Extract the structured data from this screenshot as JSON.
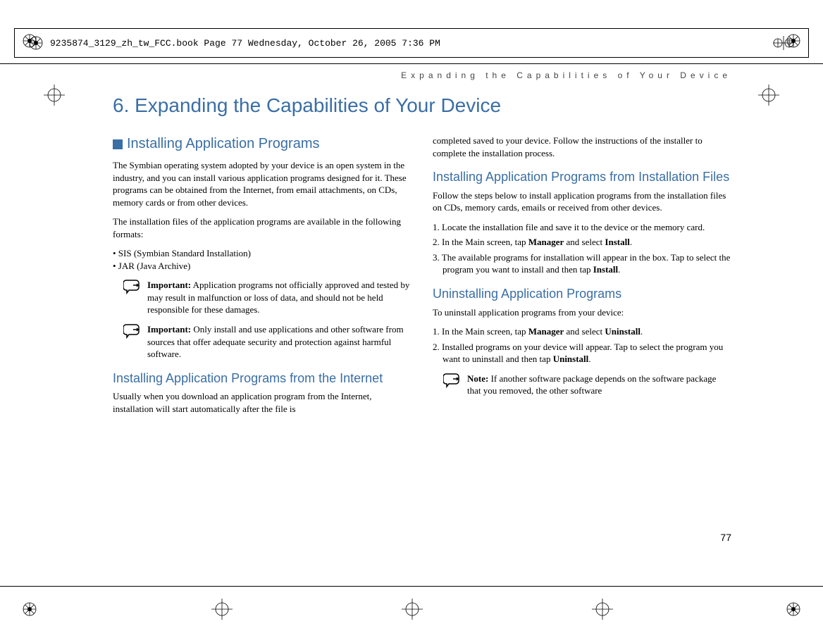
{
  "header": {
    "filemark": "9235874_3129_zh_tw_FCC.book  Page 77  Wednesday, October 26, 2005  7:36 PM"
  },
  "running_head": "Expanding the Capabilities of Your Device",
  "chapter": "6.   Expanding the Capabilities of Your Device",
  "left": {
    "h1": "Installing Application Programs",
    "p1": "The Symbian operating system adopted by your device is an open system in the industry, and you can install various application programs designed for it. These programs can be obtained from the Internet, from email attachments, on CDs, memory cards or from other devices.",
    "p2": "The installation files of the application programs are available in the following formats:",
    "b1": "• SIS (Symbian Standard Installation)",
    "b2": "• JAR (Java Archive)",
    "imp1_label": "Important:",
    "imp1": " Application programs not officially approved and tested by may result in malfunction or loss of data, and should not be held responsible for these damages.",
    "imp2_label": "Important:",
    "imp2": " Only install and use applications and other software from sources that offer adequate security and protection against harmful software.",
    "h2": "Installing Application Programs from the Internet",
    "p3": "Usually when you download an application program from the Internet, installation will start automatically after the file is"
  },
  "right": {
    "p1": "completed saved to your device. Follow the instructions of the installer to complete the installation process.",
    "h1": "Installing Application Programs from Installation Files",
    "p2": "Follow the steps below to install application programs from the installation files on CDs, memory cards, emails or received from other devices.",
    "s1": "1. Locate the installation file and save it to the device or the memory card.",
    "s2a": "2. In the Main screen, tap ",
    "s2b": "Manager",
    "s2c": " and select ",
    "s2d": "Install",
    "s2e": ".",
    "s3a": "3. The available programs for installation will appear in the box. Tap to select the program you want to install and then tap ",
    "s3b": "Install",
    "s3c": ".",
    "h2": "Uninstalling Application Programs",
    "p3": "To uninstall application programs from your device:",
    "u1a": "1. In the Main screen, tap ",
    "u1b": "Manager",
    "u1c": " and select ",
    "u1d": "Uninstall",
    "u1e": ".",
    "u2a": "2. Installed programs on your device will appear. Tap to select the program you want to uninstall and then tap ",
    "u2b": "Uninstall",
    "u2c": ".",
    "note_label": "Note:",
    "note": " If another software package depends on the software package that you removed, the other software"
  },
  "pagenum": "77"
}
